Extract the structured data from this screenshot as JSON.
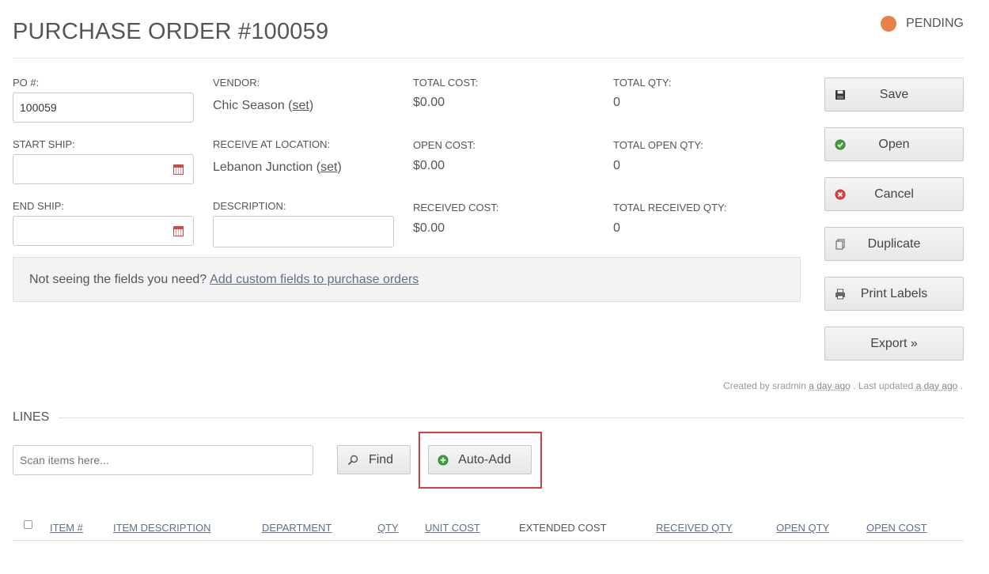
{
  "header": {
    "title": "PURCHASE ORDER #100059",
    "status": "PENDING",
    "status_color": "#e8804c"
  },
  "form": {
    "po_label": "PO #:",
    "po_value": "100059",
    "start_ship_label": "START SHIP:",
    "start_ship_value": "",
    "end_ship_label": "END SHIP:",
    "end_ship_value": "",
    "vendor_label": "VENDOR:",
    "vendor_value": "Chic Season",
    "vendor_set": "set",
    "location_label": "RECEIVE AT LOCATION:",
    "location_value": "Lebanon Junction",
    "location_set": "set",
    "description_label": "DESCRIPTION:",
    "description_value": ""
  },
  "totals": {
    "total_cost_label": "TOTAL COST:",
    "total_cost": "$0.00",
    "open_cost_label": "OPEN COST:",
    "open_cost": "$0.00",
    "received_cost_label": "RECEIVED COST:",
    "received_cost": "$0.00",
    "total_qty_label": "TOTAL QTY:",
    "total_qty": "0",
    "total_open_qty_label": "TOTAL OPEN QTY:",
    "total_open_qty": "0",
    "total_received_qty_label": "TOTAL RECEIVED QTY:",
    "total_received_qty": "0"
  },
  "notice": {
    "text": "Not seeing the fields you need?",
    "link": "Add custom fields to purchase orders"
  },
  "actions": {
    "save": "Save",
    "open": "Open",
    "cancel": "Cancel",
    "duplicate": "Duplicate",
    "print_labels": "Print Labels",
    "export": "Export »"
  },
  "meta": {
    "created_prefix": "Created by sradmin",
    "created_time": "a day ago",
    "updated_prefix": ". Last updated",
    "updated_time": "a day ago",
    "suffix": "."
  },
  "lines": {
    "title": "LINES",
    "scan_placeholder": "Scan items here...",
    "find": "Find",
    "auto_add": "Auto-Add",
    "columns": [
      "ITEM #",
      "ITEM DESCRIPTION",
      "DEPARTMENT",
      "QTY",
      "UNIT COST",
      "EXTENDED COST",
      "RECEIVED QTY",
      "OPEN QTY",
      "OPEN COST"
    ]
  }
}
